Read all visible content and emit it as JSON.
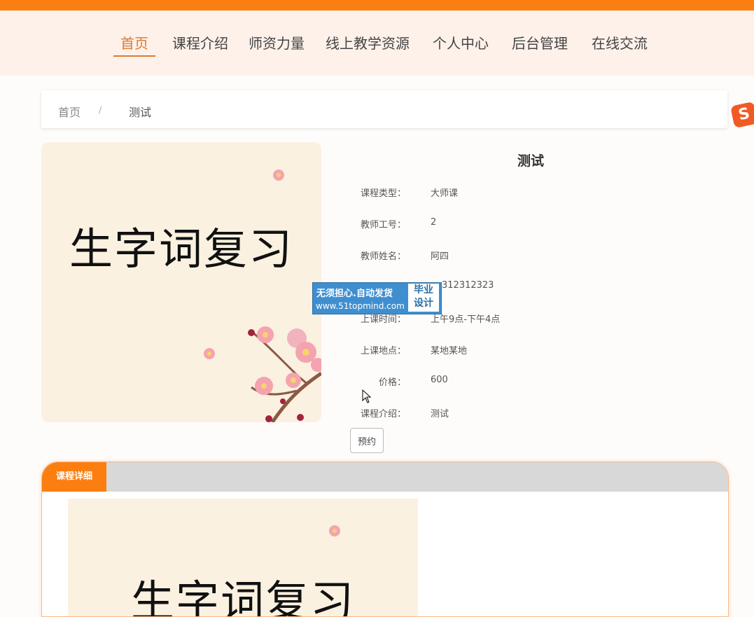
{
  "nav": {
    "items": [
      {
        "label": "首页",
        "active": true
      },
      {
        "label": "课程介绍"
      },
      {
        "label": "师资力量"
      },
      {
        "label": "线上教学资源"
      },
      {
        "label": "个人中心"
      },
      {
        "label": "后台管理"
      },
      {
        "label": "在线交流"
      }
    ]
  },
  "breadcrumb": {
    "home": "首页",
    "separator": "/",
    "current": "测试"
  },
  "course": {
    "image_text": "生字词复习",
    "title": "测试",
    "fields": [
      {
        "label": "课程类型：",
        "value": "大师课"
      },
      {
        "label": "教师工号：",
        "value": "2"
      },
      {
        "label": "教师姓名：",
        "value": "阿四"
      },
      {
        "label": "",
        "value": "312312323"
      },
      {
        "label": "上课时间：",
        "value": "上午9点-下午4点"
      },
      {
        "label": "上课地点：",
        "value": "某地某地"
      },
      {
        "label": "价格：",
        "value": "600"
      },
      {
        "label": "课程介绍：",
        "value": "测试"
      }
    ],
    "book_button": "预约"
  },
  "watermark": {
    "line1": "无须担心.自动发货",
    "line2": "www.51topmind.com",
    "badge_line1": "毕业",
    "badge_line2": "设计"
  },
  "panel": {
    "tab": "课程详细",
    "image_text": "生字词复习"
  },
  "colors": {
    "accent": "#fb7f10",
    "nav_active": "#e0792a",
    "nav_bg": "#fdf1ea"
  }
}
